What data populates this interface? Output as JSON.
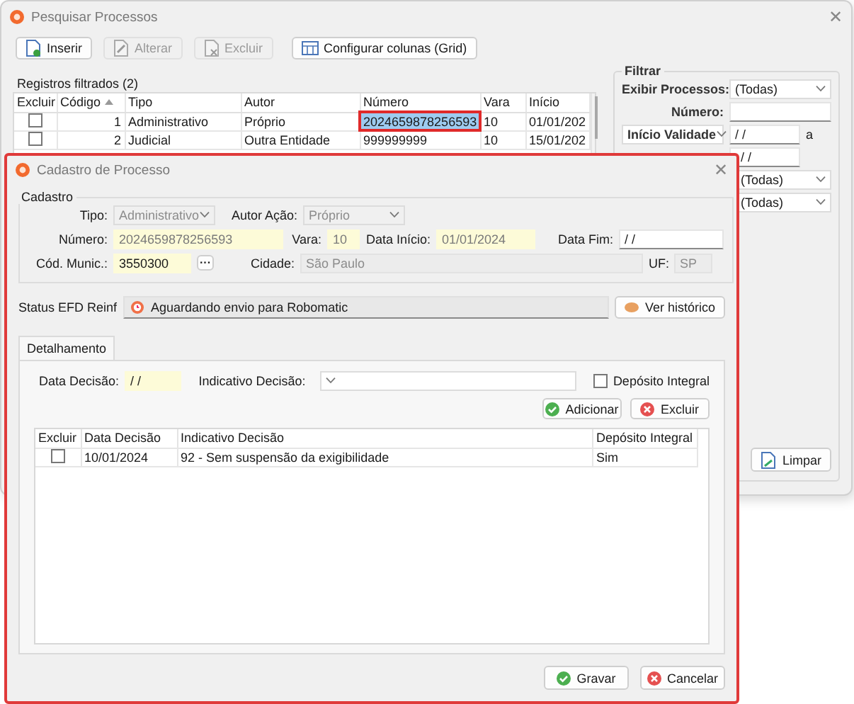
{
  "search_window": {
    "title": "Pesquisar Processos",
    "close_button": "✕",
    "toolbar": [
      {
        "label": "Inserir",
        "kind": "insert",
        "disabled": false
      },
      {
        "label": "Alterar",
        "kind": "edit",
        "disabled": true
      },
      {
        "label": "Excluir",
        "kind": "delete",
        "disabled": true
      },
      {
        "label": "Configurar colunas (Grid)",
        "kind": "grid",
        "disabled": false
      }
    ],
    "records_label": "Registros filtrados (2)",
    "table": {
      "columns": [
        {
          "label": "Excluir",
          "sorted": false
        },
        {
          "label": "Código",
          "sorted": true
        },
        {
          "label": "Tipo",
          "sorted": false
        },
        {
          "label": "Autor",
          "sorted": false
        },
        {
          "label": "Número",
          "sorted": false
        },
        {
          "label": "Vara",
          "sorted": false
        },
        {
          "label": "Início",
          "sorted": false
        }
      ],
      "rows": [
        {
          "excluir": false,
          "codigo": "1",
          "tipo": "Administrativo",
          "autor": "Próprio",
          "numero": "2024659878256593",
          "vara": "10",
          "inicio": "01/01/202",
          "selected": true
        },
        {
          "excluir": false,
          "codigo": "2",
          "tipo": "Judicial",
          "autor": "Outra Entidade",
          "numero": "999999999",
          "vara": "10",
          "inicio": "15/01/202",
          "selected": false
        }
      ]
    },
    "filter": {
      "title": "Filtrar",
      "exibir_label": "Exibir Processos:",
      "exibir_value": "(Todas)",
      "numero_label": "Número:",
      "date_type": "Início Validade",
      "date_from": "/ /",
      "range_sep": "a",
      "date_to": "/ /",
      "select_3": "(Todas)",
      "select_4": "(Todas)",
      "clear_button": "Limpar"
    }
  },
  "dialog": {
    "title": "Cadastro de Processo",
    "close_button": "✕",
    "group": "Cadastro",
    "tipo": {
      "label": "Tipo:",
      "value": "Administrativo",
      "disabled": true
    },
    "autor": {
      "label": "Autor Ação:",
      "value": "Próprio",
      "disabled": true
    },
    "numero": {
      "label": "Número:",
      "value": "2024659878256593",
      "required": true,
      "disabled": true
    },
    "vara": {
      "label": "Vara:",
      "value": "10",
      "required": true,
      "disabled": true
    },
    "data_inicio": {
      "label": "Data Início:",
      "value": "01/01/2024",
      "required": true,
      "disabled": true
    },
    "data_fim": {
      "label": "Data Fim:",
      "value": "/ /",
      "required": false,
      "disabled": false
    },
    "cod_munic": {
      "label": "Cód. Munic.:",
      "value": "3550300",
      "required": true,
      "disabled": false
    },
    "lookup_button": "···",
    "cidade": {
      "label": "Cidade:",
      "value": "São Paulo",
      "required": false,
      "disabled": true
    },
    "uf": {
      "label": "UF:",
      "value": "SP",
      "required": false,
      "disabled": true
    },
    "status": {
      "label": "Status EFD Reinf",
      "value": "Aguardando envio para Robomatic",
      "history_button": "Ver histórico"
    },
    "tabs": [
      {
        "label": "Detalhamento",
        "selected": true
      }
    ],
    "data_decisao": {
      "label": "Data Decisão:",
      "value": "/ /",
      "required": true,
      "disabled": false
    },
    "indicativo_label": "Indicativo Decisão:",
    "deposito": {
      "label": "Depósito Integral",
      "checked": false
    },
    "actions": [
      {
        "label": "Adicionar",
        "kind": "add"
      },
      {
        "label": "Excluir",
        "kind": "delete"
      }
    ],
    "table": {
      "columns": [
        "Excluir",
        "Data Decisão",
        "Indicativo Decisão",
        "Depósito Integral"
      ],
      "rows": [
        {
          "excluir": false,
          "data": "10/01/2024",
          "indicativo": "92 - Sem suspensão da exigibilidade",
          "deposito": "Sim"
        }
      ]
    },
    "buttons": [
      {
        "label": "Gravar",
        "kind": "ok"
      },
      {
        "label": "Cancelar",
        "kind": "cancel"
      }
    ]
  }
}
